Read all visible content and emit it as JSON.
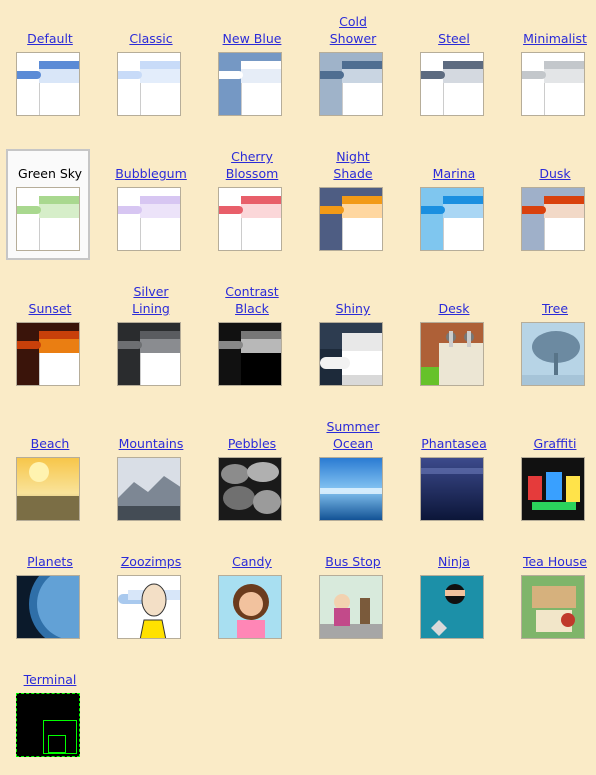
{
  "themes": [
    {
      "label": "Default",
      "style": "skin",
      "bg": "#ffffff",
      "top": "#5b8bd6",
      "strip": "#d9e6f8",
      "tab": "#5b8bd6",
      "left": "#ffffff"
    },
    {
      "label": "Classic",
      "style": "skin",
      "bg": "#ffffff",
      "top": "#c8dbf8",
      "strip": "#e3edfb",
      "tab": "#c8dbf8",
      "left": "#ffffff"
    },
    {
      "label": "New Blue",
      "style": "skin",
      "bg": "#7598c4",
      "top": "#ffffff",
      "strip": "#e6edf7",
      "tab": "#ffffff",
      "left": "#7598c4"
    },
    {
      "label": "Cold\nShower",
      "style": "skin",
      "bg": "#9fb3c9",
      "top": "#4f6e91",
      "strip": "#c9d5e2",
      "tab": "#4f6e91",
      "left": "#9fb3c9"
    },
    {
      "label": "Steel",
      "style": "skin",
      "bg": "#ffffff",
      "top": "#5d6b80",
      "strip": "#d4d9e0",
      "tab": "#5d6b80",
      "left": "#ffffff"
    },
    {
      "label": "Minimalist",
      "style": "skin",
      "bg": "#ffffff",
      "top": "#c3c7cb",
      "strip": "#e3e5e7",
      "tab": "#c3c7cb",
      "left": "#ffffff"
    },
    {
      "label": "Green Sky",
      "style": "skin",
      "bg": "#ffffff",
      "top": "#a9d88f",
      "strip": "#d6eec9",
      "tab": "#a9d88f",
      "left": "#ffffff",
      "selected": true
    },
    {
      "label": "Bubblegum",
      "style": "skin",
      "bg": "#ffffff",
      "top": "#d7c6f2",
      "strip": "#ece3f9",
      "tab": "#d7c6f2",
      "left": "#ffffff"
    },
    {
      "label": "Cherry\nBlossom",
      "style": "skin",
      "bg": "#ffffff",
      "top": "#e85f6a",
      "strip": "#fbd7d9",
      "tab": "#e85f6a",
      "left": "#ffffff"
    },
    {
      "label": "Night\nShade",
      "style": "skin",
      "bg": "#4e5d83",
      "top": "#f29a17",
      "strip": "#ffd7a0",
      "tab": "#f29a17",
      "left": "#4e5d83"
    },
    {
      "label": "Marina",
      "style": "skin",
      "bg": "#7fc6ef",
      "top": "#1b8fe0",
      "strip": "#a9d6f4",
      "tab": "#1b8fe0",
      "left": "#7fc6ef"
    },
    {
      "label": "Dusk",
      "style": "skin",
      "bg": "#9fb0c9",
      "top": "#d9410d",
      "strip": "#f2d9c7",
      "tab": "#d9410d",
      "left": "#9fb0c9"
    },
    {
      "label": "Sunset",
      "style": "skin",
      "bg": "#3a140a",
      "top": "#c8400a",
      "strip": "#ea7e12",
      "tab": "#c8400a",
      "left": "#3a140a"
    },
    {
      "label": "Silver\nLining",
      "style": "skin",
      "bg": "#2a2c2e",
      "top": "#5a5c60",
      "strip": "#8a8c90",
      "tab": "#6d6f72",
      "left": "#2a2c2e"
    },
    {
      "label": "Contrast\nBlack",
      "style": "skin",
      "bg": "#111111",
      "top": "#777777",
      "strip": "#b8b8b8",
      "tab": "#888888",
      "left": "#000000",
      "body": "#000000"
    },
    {
      "label": "Shiny",
      "style": "shiny"
    },
    {
      "label": "Desk",
      "style": "desk"
    },
    {
      "label": "Tree",
      "style": "tree"
    },
    {
      "label": "Beach",
      "style": "beach"
    },
    {
      "label": "Mountains",
      "style": "mountains"
    },
    {
      "label": "Pebbles",
      "style": "pebbles"
    },
    {
      "label": "Summer\nOcean",
      "style": "ocean"
    },
    {
      "label": "Phantasea",
      "style": "phantasea"
    },
    {
      "label": "Graffiti",
      "style": "graffiti"
    },
    {
      "label": "Planets",
      "style": "planets"
    },
    {
      "label": "Zoozimps",
      "style": "zoozimps"
    },
    {
      "label": "Candy",
      "style": "candy"
    },
    {
      "label": "Bus Stop",
      "style": "busstop"
    },
    {
      "label": "Ninja",
      "style": "ninja"
    },
    {
      "label": "Tea House",
      "style": "teahouse"
    },
    {
      "label": "Terminal",
      "style": "terminal"
    }
  ]
}
